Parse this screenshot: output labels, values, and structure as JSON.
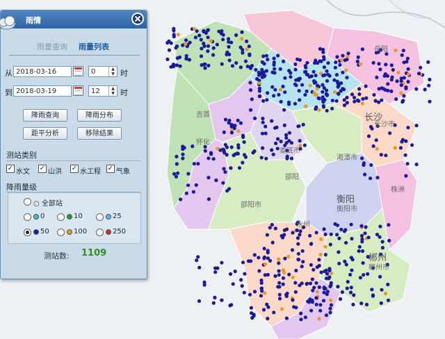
{
  "panel": {
    "title": "雨情",
    "tabs": [
      {
        "label": "雨量查询"
      },
      {
        "label": "雨量列表"
      }
    ],
    "from_label": "从:",
    "to_label": "到:",
    "from_date": "2018-03-16",
    "from_hour": "0",
    "to_date": "2018-03-19",
    "to_hour": "12",
    "hour_unit": "时",
    "buttons": [
      "降雨查询",
      "降雨分布",
      "距平分析",
      "移除结果"
    ],
    "station_type_title": "测站类别",
    "station_types": [
      "水文",
      "山洪",
      "水工程",
      "气象"
    ],
    "rain_level_title": "降雨量级",
    "all_stations": "全部站",
    "levels": [
      {
        "label": "0",
        "color": "#35c0c9"
      },
      {
        "label": "10",
        "color": "#1f9a2e"
      },
      {
        "label": "25",
        "color": "#5fb2e8"
      },
      {
        "label": "50",
        "color": "#1b1b9c"
      },
      {
        "label": "100",
        "color": "#e39a2a"
      },
      {
        "label": "250",
        "color": "#d22a2a"
      }
    ],
    "selected_level": "50",
    "count_label": "测站数:",
    "count_value": "1109"
  },
  "map": {
    "labels": [
      "长沙",
      "长沙市",
      "湘潭市",
      "娄底市",
      "邵阳市",
      "邵阳",
      "衡阳",
      "衡阳市",
      "怀化",
      "吉首",
      "郴州",
      "郴州市",
      "永州",
      "株洲",
      "岳阳"
    ],
    "dot_color": "#1a1a9a",
    "dot_alt_color": "#e39a2a"
  }
}
